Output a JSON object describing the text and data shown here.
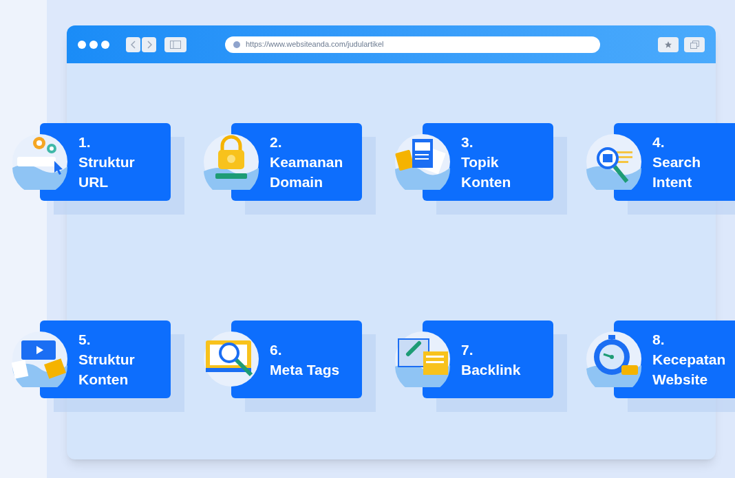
{
  "browser": {
    "url": "https://www.websiteanda.com/judulartikel"
  },
  "cards": [
    {
      "number": "1.",
      "title_lines": [
        "Struktur",
        "URL"
      ]
    },
    {
      "number": "2.",
      "title_lines": [
        "Keamanan",
        "Domain"
      ]
    },
    {
      "number": "3.",
      "title_lines": [
        "Topik",
        "Konten"
      ]
    },
    {
      "number": "4.",
      "title_lines": [
        "Search",
        "Intent"
      ]
    },
    {
      "number": "5.",
      "title_lines": [
        "Struktur",
        "Konten"
      ]
    },
    {
      "number": "6.",
      "title_lines": [
        "Meta Tags"
      ]
    },
    {
      "number": "7.",
      "title_lines": [
        "Backlink"
      ]
    },
    {
      "number": "8.",
      "title_lines": [
        "Kecepatan",
        "Website"
      ]
    }
  ]
}
